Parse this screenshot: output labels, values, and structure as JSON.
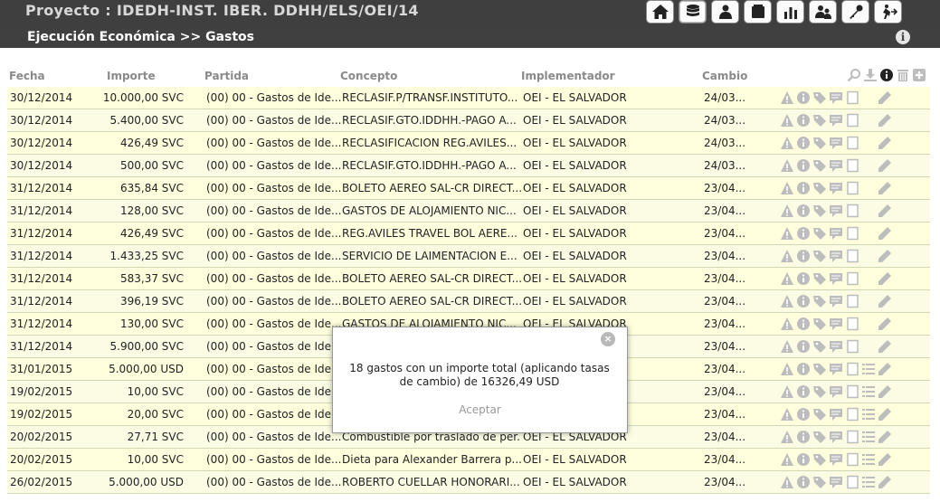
{
  "header": {
    "title": "Proyecto : IDEDH-INST. IBER. DDHH/ELS/OEI/14",
    "breadcrumb": "Ejecución Económica  >> Gastos",
    "nav_icons": [
      "home-icon",
      "database-icon",
      "person-icon",
      "wallet-icon",
      "bar-chart-icon",
      "users-icon",
      "key-icon",
      "exit-icon"
    ]
  },
  "table": {
    "columns": [
      "Fecha",
      "Importe",
      "Partida",
      "Concepto",
      "Implementador",
      "Cambio"
    ],
    "header_icons": [
      "search-icon",
      "download-icon",
      "info-icon",
      "trash-icon",
      "add-icon"
    ],
    "rows": [
      {
        "fecha": "30/12/2014",
        "importe": "10.000,00 SVC",
        "partida": "(00) 00 - Gastos de Ide...",
        "concepto": "RECLASIF.P/TRANSF.INSTITUTO...",
        "implementador": "OEI - EL SALVADOR",
        "cambio": "24/03...",
        "list": false
      },
      {
        "fecha": "30/12/2014",
        "importe": "5.400,00 SVC",
        "partida": "(00) 00 - Gastos de Ide...",
        "concepto": "RECLASIF.GTO.IDDHH.-PAGO A...",
        "implementador": "OEI - EL SALVADOR",
        "cambio": "24/03...",
        "list": false
      },
      {
        "fecha": "30/12/2014",
        "importe": "426,49 SVC",
        "partida": "(00) 00 - Gastos de Ide...",
        "concepto": "RECLASIFICACION REG.AVILES...",
        "implementador": "OEI - EL SALVADOR",
        "cambio": "24/03...",
        "list": false
      },
      {
        "fecha": "30/12/2014",
        "importe": "500,00 SVC",
        "partida": "(00) 00 - Gastos de Ide...",
        "concepto": "RECLASIF.GTO.IDDHH.-PAGO A...",
        "implementador": "OEI - EL SALVADOR",
        "cambio": "24/03...",
        "list": false
      },
      {
        "fecha": "31/12/2014",
        "importe": "635,84 SVC",
        "partida": "(00) 00 - Gastos de Ide...",
        "concepto": "BOLETO AEREO SAL-CR DIRECT...",
        "implementador": "OEI - EL SALVADOR",
        "cambio": "23/04...",
        "list": false
      },
      {
        "fecha": "31/12/2014",
        "importe": "128,00 SVC",
        "partida": "(00) 00 - Gastos de Ide...",
        "concepto": "GASTOS DE ALOJAMIENTO NIC...",
        "implementador": "OEI - EL SALVADOR",
        "cambio": "23/04...",
        "list": false
      },
      {
        "fecha": "31/12/2014",
        "importe": "426,49 SVC",
        "partida": "(00) 00 - Gastos de Ide...",
        "concepto": "REG.AVILES TRAVEL BOL AERE...",
        "implementador": "OEI - EL SALVADOR",
        "cambio": "23/04...",
        "list": false
      },
      {
        "fecha": "31/12/2014",
        "importe": "1.433,25 SVC",
        "partida": "(00) 00 - Gastos de Ide...",
        "concepto": "SERVICIO DE LAIMENTACION E...",
        "implementador": "OEI - EL SALVADOR",
        "cambio": "23/04...",
        "list": false
      },
      {
        "fecha": "31/12/2014",
        "importe": "583,37 SVC",
        "partida": "(00) 00 - Gastos de Ide...",
        "concepto": "BOLETO AEREO SAL-CR DIRECT...",
        "implementador": "OEI - EL SALVADOR",
        "cambio": "23/04...",
        "list": false
      },
      {
        "fecha": "31/12/2014",
        "importe": "396,19 SVC",
        "partida": "(00) 00 - Gastos de Ide...",
        "concepto": "BOLETO AEREO SAL-CR DIRECT...",
        "implementador": "OEI - EL SALVADOR",
        "cambio": "23/04...",
        "list": false
      },
      {
        "fecha": "31/12/2014",
        "importe": "130,00 SVC",
        "partida": "(00) 00 - Gastos de Ide...",
        "concepto": "GASTOS DE ALOJAMIENTO NIC...",
        "implementador": "OEI - EL SALVADOR",
        "cambio": "23/04...",
        "list": false
      },
      {
        "fecha": "31/12/2014",
        "importe": "5.900,00 SVC",
        "partida": "(00) 00 - Gastos de Ide...",
        "concepto": "",
        "implementador": "",
        "cambio": "23/04...",
        "list": false
      },
      {
        "fecha": "31/01/2015",
        "importe": "5.000,00 USD",
        "partida": "(00) 00 - Gastos de Ide...",
        "concepto": "",
        "implementador": "",
        "cambio": "23/04...",
        "list": true
      },
      {
        "fecha": "19/02/2015",
        "importe": "10,00 SVC",
        "partida": "(00) 00 - Gastos de Ide...",
        "concepto": "",
        "implementador": "",
        "cambio": "23/04...",
        "list": true
      },
      {
        "fecha": "19/02/2015",
        "importe": "20,00 SVC",
        "partida": "(00) 00 - Gastos de Ide...",
        "concepto": "",
        "implementador": "",
        "cambio": "23/04...",
        "list": true
      },
      {
        "fecha": "20/02/2015",
        "importe": "27,71 SVC",
        "partida": "(00) 00 - Gastos de Ide...",
        "concepto": "Combustible por traslado de per...",
        "implementador": "OEI - EL SALVADOR",
        "cambio": "23/04...",
        "list": true
      },
      {
        "fecha": "20/02/2015",
        "importe": "10,00 SVC",
        "partida": "(00) 00 - Gastos de Ide...",
        "concepto": "Dieta para Alexander Barrera p...",
        "implementador": "OEI - EL SALVADOR",
        "cambio": "23/04...",
        "list": true
      },
      {
        "fecha": "26/02/2015",
        "importe": "5.000,00 USD",
        "partida": "(00) 00 - Gastos de Ide...",
        "concepto": "ROBERTO CUELLAR HONORARI...",
        "implementador": "OEI - EL SALVADOR",
        "cambio": "23/04...",
        "list": true
      }
    ]
  },
  "dialog": {
    "message": "18 gastos con un importe total (aplicando tasas de cambio) de 16326,49 USD",
    "accept_label": "Aceptar",
    "close_label": "×"
  },
  "colors": {
    "topbar": "#3f3f3f",
    "row_bg": "#ffffdd",
    "row_border": "#cfd7b3",
    "header_text": "#8a8a8a",
    "icon_gray": "#bdbdbd"
  }
}
